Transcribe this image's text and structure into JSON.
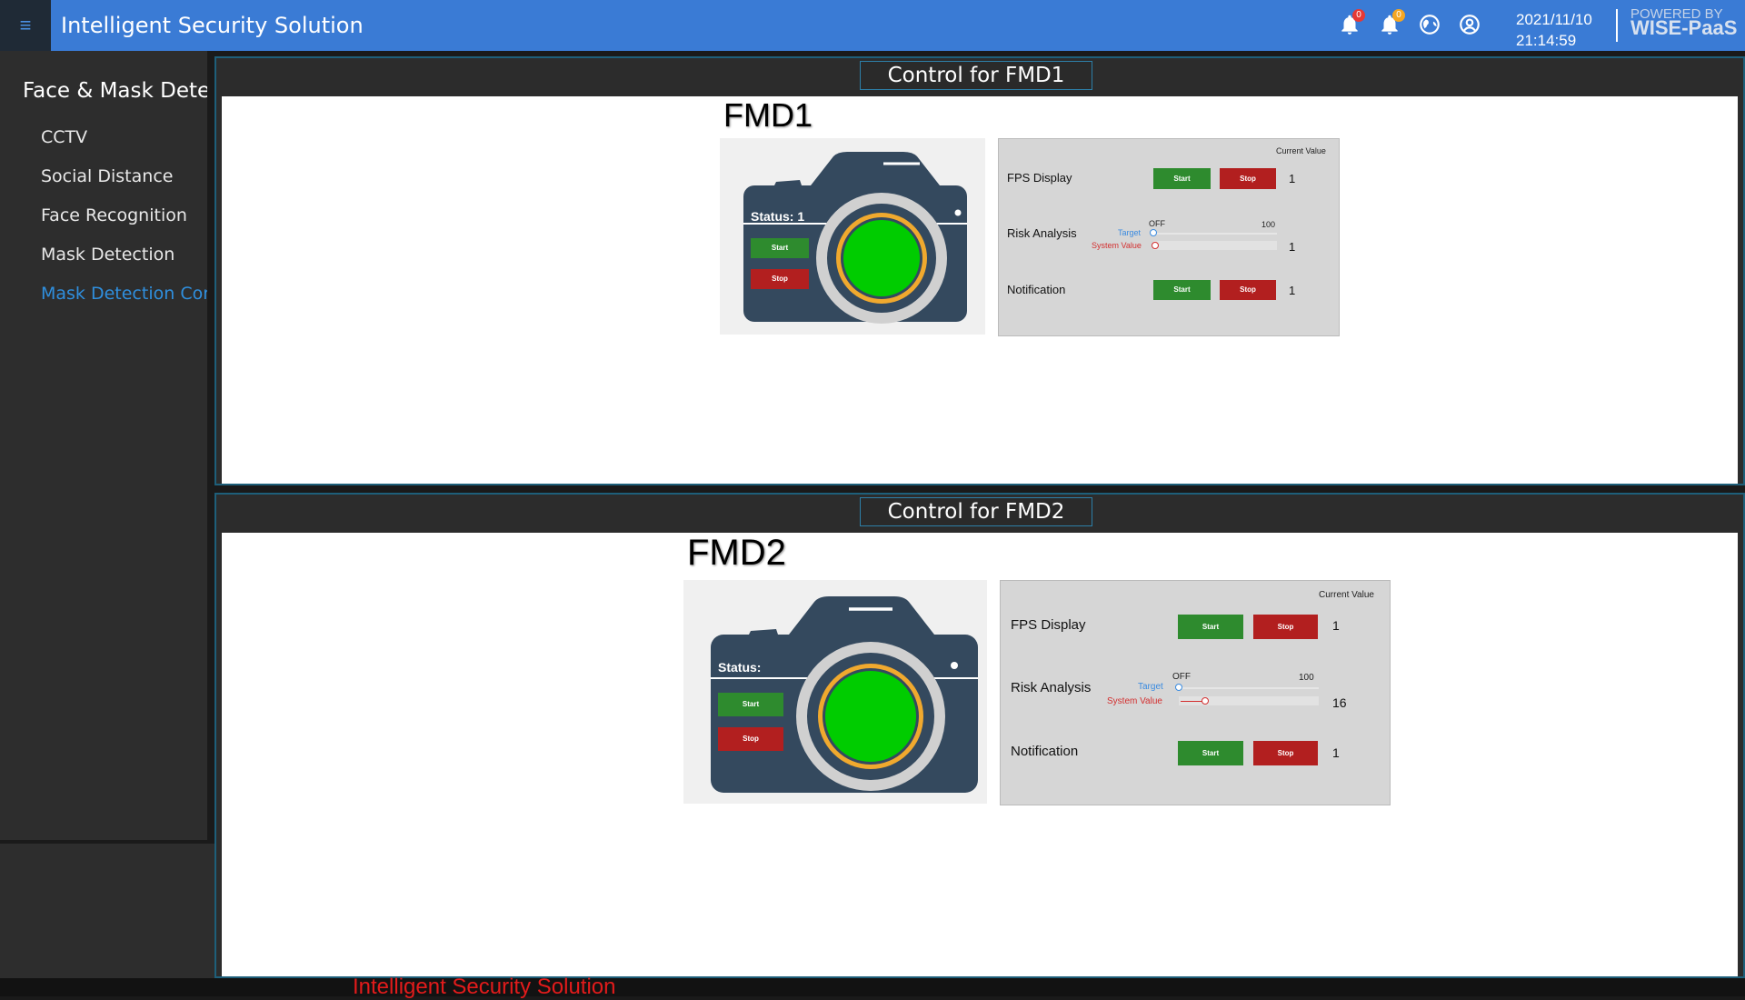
{
  "header": {
    "title": "Intelligent Security Solution",
    "notif_red_count": "0",
    "notif_orange_count": "0",
    "date": "2021/11/10",
    "time": "21:14:59",
    "powered_by": "POWERED BY",
    "brand": "WISE-PaaS"
  },
  "sidebar": {
    "heading": "Face & Mask Dete",
    "items": [
      {
        "label": "CCTV"
      },
      {
        "label": "Social Distance"
      },
      {
        "label": "Face Recognition"
      },
      {
        "label": "Mask Detection"
      },
      {
        "label": "Mask Detection Cor"
      }
    ]
  },
  "panels": [
    {
      "title": "Control for FMD1",
      "device": "FMD1",
      "status": "Status: 1",
      "start_label": "Start",
      "stop_label": "Stop",
      "current_value_label": "Current Value",
      "fps_label": "FPS Display",
      "fps_value": "1",
      "risk_label": "Risk Analysis",
      "risk_off": "OFF",
      "risk_max": "100",
      "target_label": "Target",
      "system_label": "System Value",
      "risk_value": "1",
      "notification_label": "Notification",
      "notification_value": "1"
    },
    {
      "title": "Control for FMD2",
      "device": "FMD2",
      "status": "Status:",
      "start_label": "Start",
      "stop_label": "Stop",
      "current_value_label": "Current Value",
      "fps_label": "FPS Display",
      "fps_value": "1",
      "risk_label": "Risk Analysis",
      "risk_off": "OFF",
      "risk_max": "100",
      "target_label": "Target",
      "system_label": "System Value",
      "risk_value": "16",
      "notification_label": "Notification",
      "notification_value": "1"
    }
  ],
  "footer": {
    "text": "Intelligent Security Solution"
  },
  "colors": {
    "topbar": "#3a7bd5",
    "active": "#2f8fde",
    "start": "#2e8b2e",
    "stop": "#b21f1f",
    "lens": "#00cc00"
  },
  "icons": [
    "menu-icon",
    "bell-icon",
    "bell-icon",
    "globe-icon",
    "user-circle-icon",
    "camera-icon"
  ]
}
